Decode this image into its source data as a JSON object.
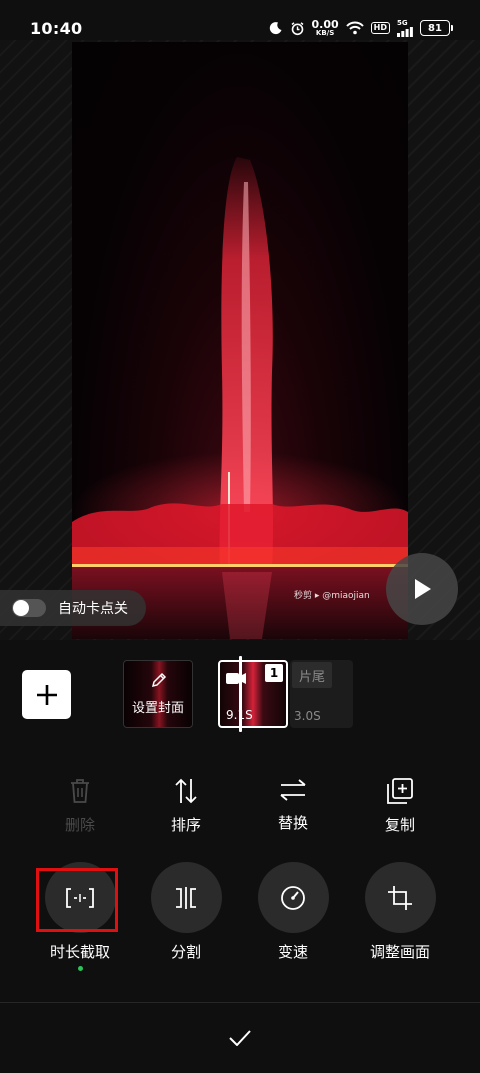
{
  "status_bar": {
    "time": "10:40",
    "net_speed_value": "0.00",
    "net_speed_unit": "KB/S",
    "hd_badge": "HD",
    "signal_generation": "5G",
    "battery_level": "81"
  },
  "preview": {
    "watermark_text": "秒剪 ▸ @miaojian",
    "auto_beat_label": "自动卡点关",
    "auto_beat_enabled": false
  },
  "timeline": {
    "cover_label": "设置封面",
    "clips": [
      {
        "index": "1",
        "duration": "9.1S",
        "selected": true
      }
    ],
    "ending_label": "片尾",
    "ending_duration": "3.0S"
  },
  "tools_row1": [
    {
      "label": "删除",
      "icon": "trash-icon",
      "enabled": false
    },
    {
      "label": "排序",
      "icon": "sort-icon",
      "enabled": true
    },
    {
      "label": "替换",
      "icon": "replace-icon",
      "enabled": true
    },
    {
      "label": "复制",
      "icon": "copy-icon",
      "enabled": true
    }
  ],
  "tools_row2": [
    {
      "label": "时长截取",
      "icon": "trim-icon",
      "active": true
    },
    {
      "label": "分割",
      "icon": "split-icon",
      "active": false
    },
    {
      "label": "变速",
      "icon": "speed-icon",
      "active": false
    },
    {
      "label": "调整画面",
      "icon": "crop-icon",
      "active": false
    }
  ],
  "colors": {
    "background": "#0f0f0f",
    "tool_circle": "#2b2b2b",
    "active_indicator": "#29c45a",
    "highlight_box": "#e01010",
    "disabled_text": "#4a4a4a"
  }
}
